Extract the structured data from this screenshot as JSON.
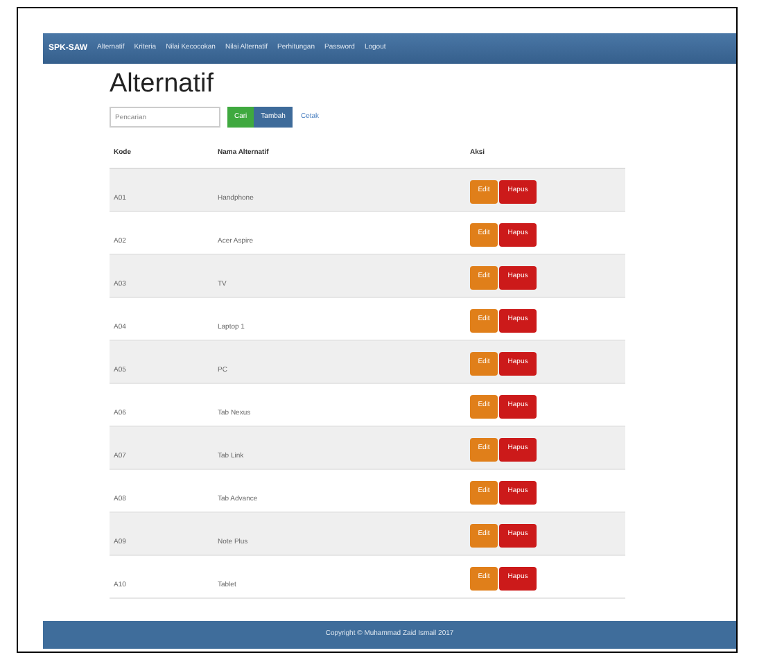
{
  "navbar": {
    "brand": "SPK-SAW",
    "items": [
      "Alternatif",
      "Kriteria",
      "Nilai Kecocokan",
      "Nilai Alternatif",
      "Perhitungan",
      "Password",
      "Logout"
    ]
  },
  "title": "Alternatif",
  "search": {
    "placeholder": "Pencarian"
  },
  "buttons": [
    {
      "label": "Cari",
      "kind": "green"
    },
    {
      "label": "Tambah",
      "kind": "blue"
    }
  ],
  "link": "Cetak",
  "table": {
    "columns": [
      "Kode",
      "Nama Alternatif",
      "Aksi"
    ],
    "rows": [
      {
        "code": "A01",
        "name": "Handphone",
        "actions": [
          "Edit",
          "Hapus"
        ]
      },
      {
        "code": "A02",
        "name": "Acer Aspire",
        "actions": [
          "Edit",
          "Hapus"
        ]
      },
      {
        "code": "A03",
        "name": "TV",
        "actions": [
          "Edit",
          "Hapus"
        ]
      },
      {
        "code": "A04",
        "name": "Laptop 1",
        "actions": [
          "Edit",
          "Hapus"
        ]
      },
      {
        "code": "A05",
        "name": "PC",
        "actions": [
          "Edit",
          "Hapus"
        ]
      },
      {
        "code": "A06",
        "name": "Tab Nexus",
        "actions": [
          "Edit",
          "Hapus"
        ]
      },
      {
        "code": "A07",
        "name": "Tab Link",
        "actions": [
          "Edit",
          "Hapus"
        ]
      },
      {
        "code": "A08",
        "name": "Tab Advance",
        "actions": [
          "Edit",
          "Hapus"
        ]
      },
      {
        "code": "A09",
        "name": "Note Plus",
        "actions": [
          "Edit",
          "Hapus"
        ]
      },
      {
        "code": "A10",
        "name": "Tablet",
        "actions": [
          "Edit",
          "Hapus"
        ]
      }
    ]
  },
  "footer": "Copyright © Muhammad Zaid Ismail 2017"
}
